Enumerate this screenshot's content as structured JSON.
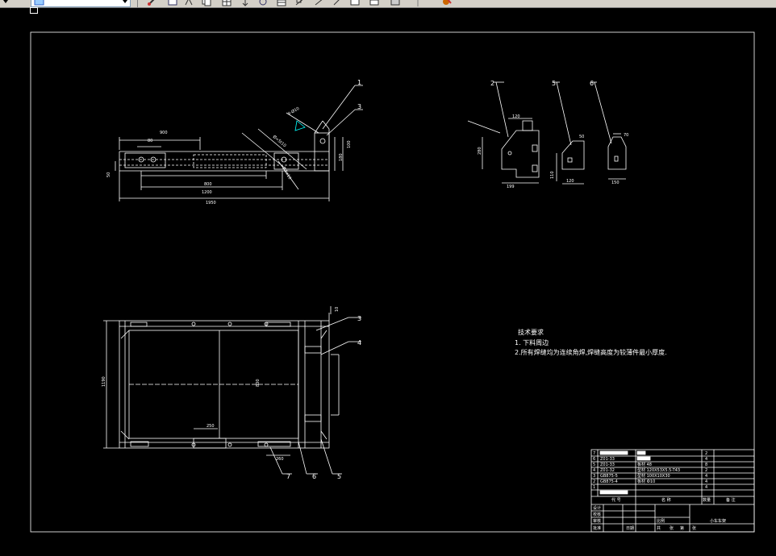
{
  "toolbar": {
    "layer_combo_value": "",
    "icons": [
      "draw-icon",
      "layer-icon",
      "snap-icon",
      "copy-icon",
      "grid-icon",
      "move-icon",
      "rotate-icon",
      "table-icon",
      "dimension-icon",
      "line-icon",
      "rectangle-icon",
      "window-icon",
      "block-icon",
      "pen-icon"
    ]
  },
  "drawing": {
    "colors": {
      "background": "#000000",
      "lines": "#ffffff",
      "accent": "#00ffff"
    },
    "side_view": {
      "balloons": [
        "1",
        "3"
      ],
      "dimensions": [
        "900",
        "80",
        "800",
        "1200",
        "1950",
        "50",
        "180",
        "100"
      ],
      "annotations": [
        "4-Ø10",
        "Ø=5t10",
        "2.5x10"
      ]
    },
    "detail_views": {
      "balloons": [
        "2",
        "5",
        "6"
      ],
      "dims_a": [
        "120",
        "280",
        "199"
      ],
      "dims_b": [
        "50",
        "120",
        "110"
      ],
      "dims_c": [
        "70",
        "150"
      ]
    },
    "plan_view": {
      "balloons": [
        "3",
        "4",
        "5",
        "6",
        "7"
      ],
      "dimensions": [
        "10",
        "1190",
        "800",
        "250",
        "260"
      ]
    },
    "tech_requirements": {
      "title": "技术要求",
      "line1": "1. 下料周边",
      "line2": "2.所有焊缝均为连续角焊,焊缝高度为较薄件最小厚度."
    },
    "title_block": {
      "rows": [
        {
          "no": "7",
          "code": "",
          "name": "",
          "qty": "2"
        },
        {
          "no": "6",
          "code": "Z01-33",
          "name": "",
          "qty": "4"
        },
        {
          "no": "5",
          "code": "Z01-33",
          "name": "板材 48",
          "qty": "8"
        },
        {
          "no": "4",
          "code": "Z01-32",
          "name": "型材 120X53X5.5-T43",
          "qty": "2"
        },
        {
          "no": "3",
          "code": "GB875-5",
          "name": "型材 100X10X30",
          "qty": "4"
        },
        {
          "no": "2",
          "code": "GB875-4",
          "name": "板材 Ф10",
          "qty": "4"
        },
        {
          "no": "1",
          "code": "",
          "name": "",
          "qty": "4"
        }
      ],
      "header": {
        "code": "代 号",
        "name": "名 称",
        "qty": "数量",
        "remark": "备 注"
      },
      "labels": [
        "设计",
        "校核",
        "审核",
        "批准",
        "日期"
      ],
      "product_name": "小车车架",
      "scale_label": "比例",
      "footer": [
        "共",
        "张",
        "第",
        "张"
      ]
    }
  }
}
